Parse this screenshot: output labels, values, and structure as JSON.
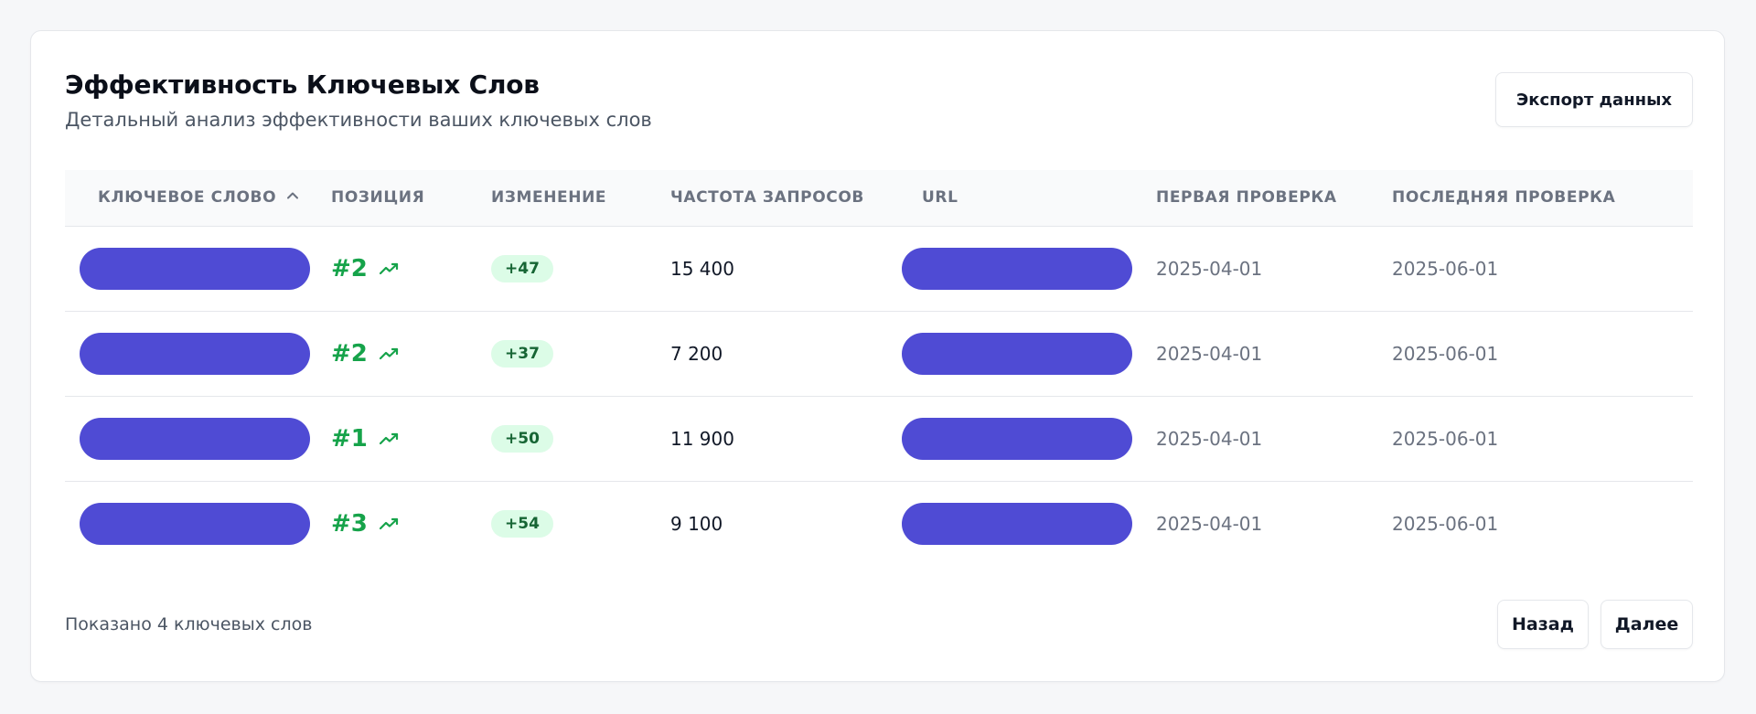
{
  "header": {
    "title": "Эффективность Ключевых Слов",
    "subtitle": "Детальный анализ эффективности ваших ключевых слов",
    "export_label": "Экспорт данных"
  },
  "table": {
    "columns": [
      "КЛЮЧЕВОЕ СЛОВО",
      "ПОЗИЦИЯ",
      "ИЗМЕНЕНИЕ",
      "ЧАСТОТА ЗАПРОСОВ",
      "URL",
      "ПЕРВАЯ ПРОВЕРКА",
      "ПОСЛЕДНЯЯ ПРОВЕРКА"
    ],
    "sort_column_icon": "chevron-up-icon",
    "rows": [
      {
        "position": "#2",
        "change": "+47",
        "frequency": "15 400",
        "first_check": "2025-04-01",
        "last_check": "2025-06-01"
      },
      {
        "position": "#2",
        "change": "+37",
        "frequency": "7 200",
        "first_check": "2025-04-01",
        "last_check": "2025-06-01"
      },
      {
        "position": "#1",
        "change": "+50",
        "frequency": "11 900",
        "first_check": "2025-04-01",
        "last_check": "2025-06-01"
      },
      {
        "position": "#3",
        "change": "+54",
        "frequency": "9 100",
        "first_check": "2025-04-01",
        "last_check": "2025-06-01"
      }
    ],
    "trend_icon": "trending-up-icon"
  },
  "footer": {
    "summary": "Показано 4 ключевых слов",
    "prev_label": "Назад",
    "next_label": "Далее"
  },
  "colors": {
    "redacted_pill": "#4f4bd4",
    "position_green": "#16a34a",
    "badge_bg": "#dcfce7",
    "badge_text": "#166534"
  }
}
